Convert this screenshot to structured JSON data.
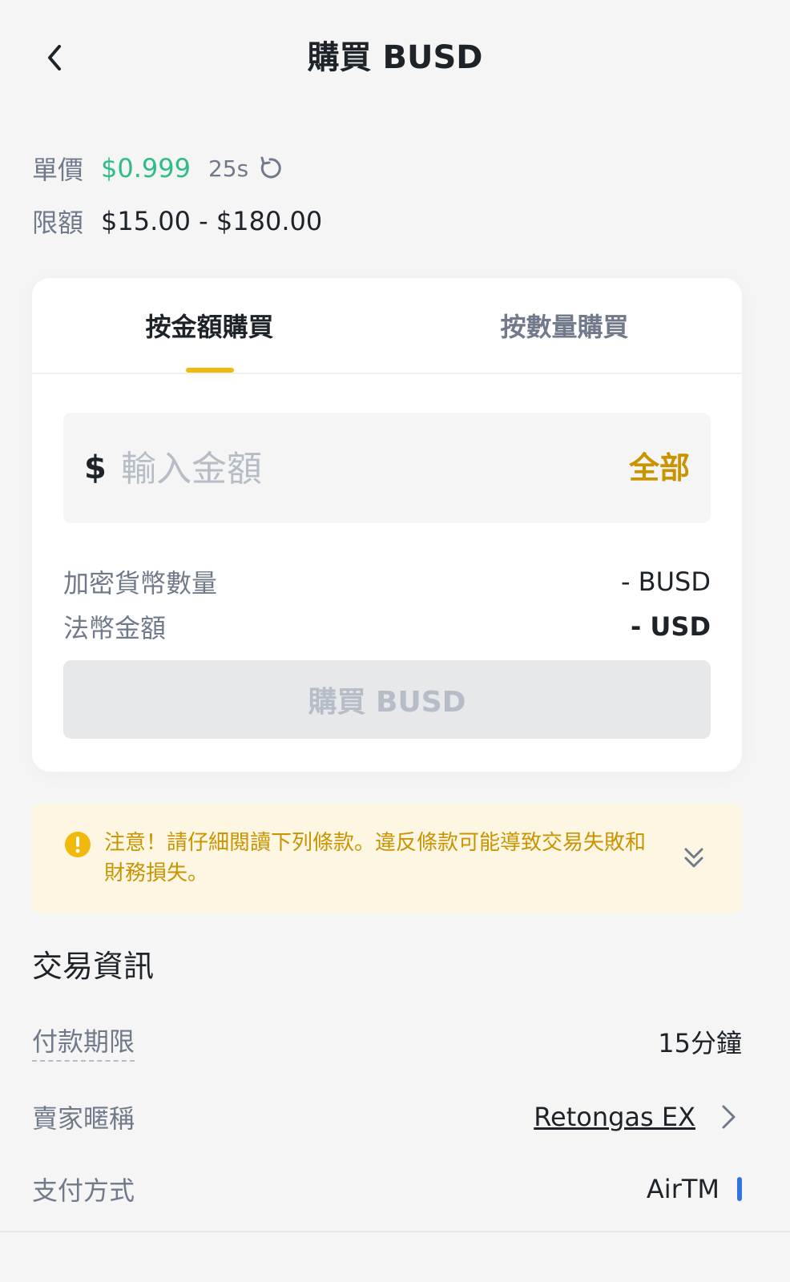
{
  "header": {
    "title": "購買 BUSD"
  },
  "price_info": {
    "unit_price_label": "單價",
    "unit_price_value": "$0.999",
    "countdown": "25s",
    "limit_label": "限額",
    "limit_value": "$15.00 - $180.00"
  },
  "tabs": [
    {
      "label": "按金額購買",
      "active": true
    },
    {
      "label": "按數量購買",
      "active": false
    }
  ],
  "amount": {
    "currency_sign": "$",
    "placeholder": "輸入金額",
    "value": "",
    "all_label": "全部"
  },
  "summary": {
    "crypto_label": "加密貨幣數量",
    "crypto_value": "- BUSD",
    "fiat_label": "法幣金額",
    "fiat_value": "- USD"
  },
  "buy_button": {
    "label": "購買 BUSD",
    "disabled": true
  },
  "notice": {
    "text": "注意！請仔細閱讀下列條款。違反條款可能導致交易失敗和財務損失。"
  },
  "trade_info": {
    "title": "交易資訊",
    "payment_period_label": "付款期限",
    "payment_period_value": "15分鐘",
    "seller_label": "賣家暱稱",
    "seller_value": "Retongas EX",
    "payment_method_label": "支付方式",
    "payment_method_value": "AirTM"
  },
  "colors": {
    "accent_yellow": "#f0b90b",
    "link_gold": "#c99400",
    "price_green": "#2ebd85",
    "text_secondary": "#707a8a",
    "payment_marker": "#3375e0"
  },
  "icons": {
    "back": "chevron-left-icon",
    "refresh": "refresh-icon",
    "warning": "exclamation-circle-icon",
    "expand": "double-chevron-down-icon",
    "seller_arrow": "chevron-right-icon"
  }
}
